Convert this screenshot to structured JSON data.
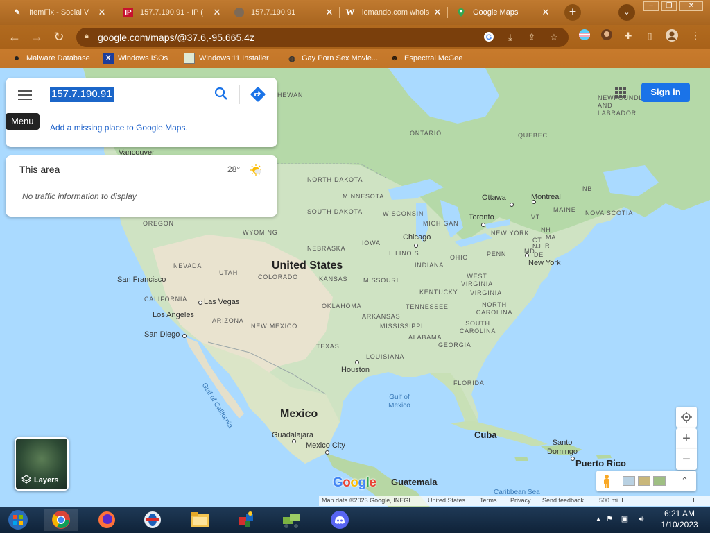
{
  "browser": {
    "tabs": [
      {
        "title": "ItemFix - Social V",
        "icon": "itemfix-favicon",
        "active": false
      },
      {
        "title": "157.7.190.91 - IP (",
        "icon": "ip-favicon",
        "active": false
      },
      {
        "title": "157.7.190.91",
        "icon": "loading-globe-favicon",
        "active": false
      },
      {
        "title": "lomando.com whois",
        "icon": "w-favicon",
        "active": false
      },
      {
        "title": "Google Maps",
        "icon": "google-maps-favicon",
        "active": true
      }
    ],
    "new_tab_label": "+",
    "url": "google.com/maps/@37.6,-95.665,4z",
    "bookmarks": [
      {
        "label": "Malware Database",
        "icon": "dot-favicon"
      },
      {
        "label": "Windows ISOs",
        "icon": "x-favicon"
      },
      {
        "label": "Windows 11 Installer",
        "icon": "image-favicon"
      },
      {
        "label": "Gay Porn Sex Movie...",
        "icon": "globe-favicon"
      },
      {
        "label": "Espectral McGee",
        "icon": "avatar-favicon"
      }
    ],
    "theme_color": "#b86f24"
  },
  "maps": {
    "search_value": "157.7.190.91",
    "menu_tooltip": "Menu",
    "add_missing_place": "Add a missing place to Google Maps.",
    "area": {
      "title": "This area",
      "temperature": "28°",
      "traffic_note": "No traffic information to display"
    },
    "sign_in": "Sign in",
    "layers_label": "Layers",
    "zoom_in": "+",
    "zoom_out": "−",
    "logo": "Google",
    "attribution": {
      "map_data": "Map data ©2023 Google, INEGI",
      "region": "United States",
      "terms": "Terms",
      "privacy": "Privacy",
      "feedback": "Send feedback",
      "scale": "500 mi"
    },
    "labels": {
      "countries": [
        "United States",
        "Mexico",
        "Cuba",
        "Guatemala",
        "Puerto Rico"
      ],
      "states": [
        "NORTH DAKOTA",
        "SOUTH DAKOTA",
        "MINNESOTA",
        "WISCONSIN",
        "MICHIGAN",
        "IOWA",
        "NEBRASKA",
        "WYOMING",
        "OREGON",
        "NEVADA",
        "UTAH",
        "COLORADO",
        "KANSAS",
        "MISSOURI",
        "ILLINOIS",
        "INDIANA",
        "OHIO",
        "PENN",
        "NEW YORK",
        "KENTUCKY",
        "WEST VIRGINIA",
        "VIRGINIA",
        "TENNESSEE",
        "NORTH CAROLINA",
        "SOUTH CAROLINA",
        "GEORGIA",
        "ALABAMA",
        "MISSISSIPPI",
        "ARKANSAS",
        "OKLAHOMA",
        "TEXAS",
        "LOUISIANA",
        "NEW MEXICO",
        "ARIZONA",
        "CALIFORNIA",
        "FLORIDA",
        "ONTARIO",
        "QUEBEC",
        "NEWFOUNDLAND AND LABRADOR",
        "NOVA SCOTIA",
        "NB",
        "MAINE",
        "VT",
        "NH",
        "MA",
        "CT",
        "RI",
        "MD",
        "NJ",
        "DE",
        "HEWAN"
      ],
      "cities": [
        "Vancouver",
        "San Francisco",
        "Las Vegas",
        "Los Angeles",
        "San Diego",
        "Chicago",
        "Toronto",
        "Ottawa",
        "Montreal",
        "New York",
        "Houston",
        "Guadalajara",
        "Mexico City",
        "Santo Domingo"
      ],
      "water": [
        "Gulf of Mexico",
        "Gulf of California",
        "Caribbean Sea"
      ]
    }
  },
  "taskbar": {
    "time": "6:21 AM",
    "date": "1/10/2023",
    "apps": [
      "start-orb",
      "chrome",
      "firefox",
      "opera",
      "file-explorer",
      "paint-app",
      "network-app",
      "discord"
    ]
  }
}
